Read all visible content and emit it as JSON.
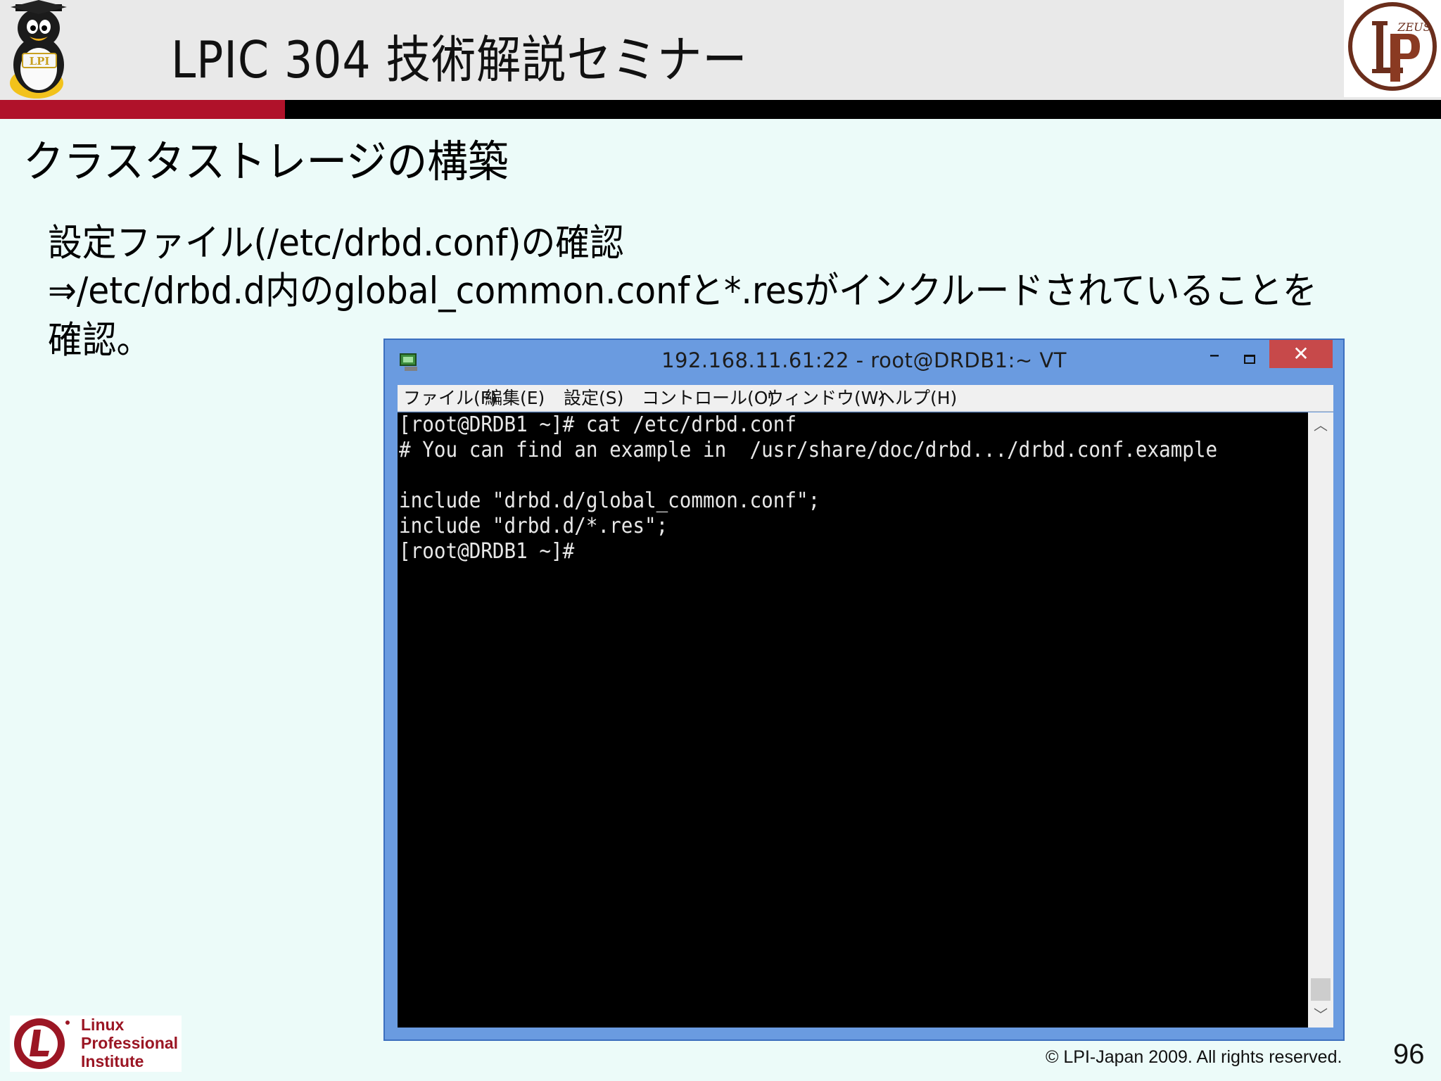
{
  "header": {
    "deck_title": "LPIC 304 技術解説セミナー",
    "logo_label": "ZEUS"
  },
  "slide": {
    "title": "クラスタストレージの構築",
    "body_lines": [
      "設定ファイル(/etc/drbd.conf)の確認",
      "⇒/etc/drbd.d内のglobal_common.confと*.resがインクルードされていることを",
      "確認。"
    ]
  },
  "window": {
    "title": "192.168.11.61:22 - root@DRDB1:~ VT",
    "minimize_glyph": "–",
    "close_glyph": "✕",
    "menu": [
      "ファイル(F)",
      "編集(E)",
      "設定(S)",
      "コントロール(O)",
      "ウィンドウ(W)",
      "ヘルプ(H)"
    ],
    "terminal_lines": [
      "[root@DRDB1 ~]# cat /etc/drbd.conf",
      "# You can find an example in  /usr/share/doc/drbd.../drbd.conf.example",
      "",
      "include \"drbd.d/global_common.conf\";",
      "include \"drbd.d/*.res\";",
      "[root@DRDB1 ~]#"
    ],
    "scroll_up_glyph": "︿",
    "scroll_down_glyph": "﹀"
  },
  "footer": {
    "lpi_lines": [
      "Linux",
      "Professional",
      "Institute"
    ],
    "copyright": "© LPI-Japan 2009. All rights reserved.",
    "page_number": "96"
  },
  "colors": {
    "background": "#ecfbf9",
    "header_bg": "#e9e9e9",
    "accent_red": "#b0122a",
    "window_frame": "#6a9be0",
    "close_button": "#c7494a",
    "terminal_bg": "#000000",
    "terminal_fg": "#e8e8e8"
  }
}
